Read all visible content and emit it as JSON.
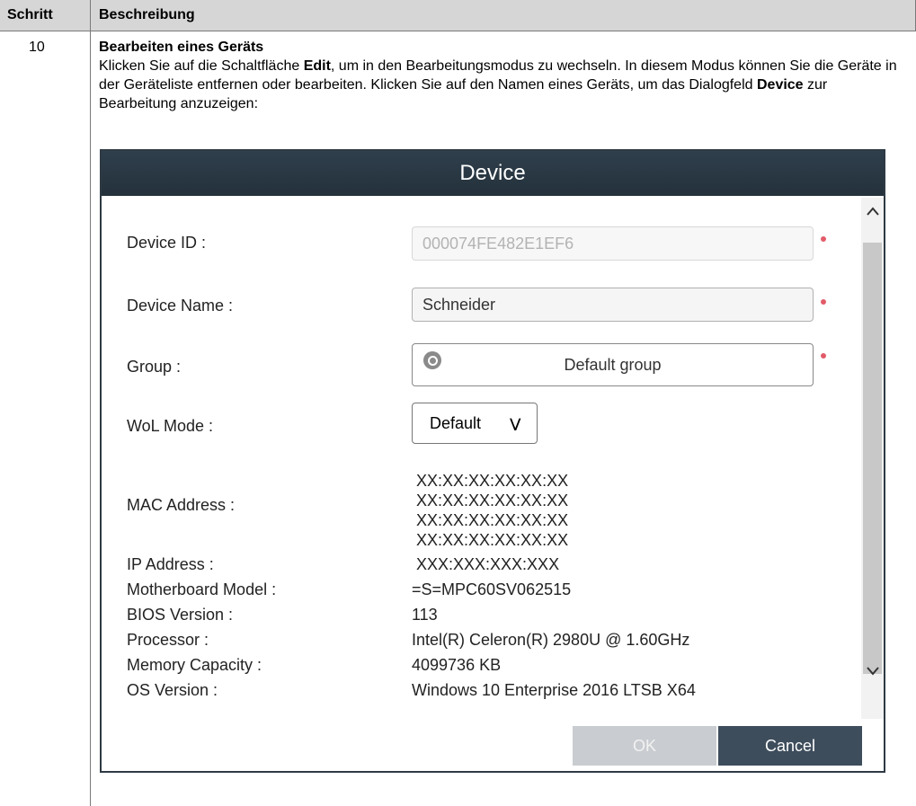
{
  "table": {
    "header_step": "Schritt",
    "header_description": "Beschreibung",
    "step_number": "10",
    "step_title": "Bearbeiten eines Geräts",
    "text_1": "Klicken Sie auf die Schaltfläche ",
    "edit_word": "Edit",
    "text_2": ", um in den Bearbeitungsmodus zu wechseln. In diesem Modus können Sie die Geräte in der Geräteliste entfernen oder bearbeiten. Klicken Sie auf den Namen eines Geräts, um das Dialogfeld ",
    "device_word": "Device",
    "text_3": " zur Bearbeitung anzuzeigen:"
  },
  "dialog": {
    "title": "Device",
    "labels": {
      "device_id": "Device ID :",
      "device_name": "Device Name :",
      "group": "Group :",
      "wol_mode": "WoL Mode :",
      "mac_address": "MAC Address :",
      "ip_address": "IP Address :",
      "motherboard_model": "Motherboard Model :",
      "bios_version": "BIOS Version :",
      "processor": "Processor :",
      "memory_capacity": "Memory Capacity :",
      "os_version": "OS Version :"
    },
    "values": {
      "device_id": "000074FE482E1EF6",
      "device_name": "Schneider",
      "group": "Default group",
      "wol_mode": "Default",
      "mac_addresses": [
        "XX:XX:XX:XX:XX:XX",
        "XX:XX:XX:XX:XX:XX",
        "XX:XX:XX:XX:XX:XX",
        "XX:XX:XX:XX:XX:XX"
      ],
      "ip_address": "XXX:XXX:XXX:XXX",
      "motherboard_model": "=S=MPC60SV062515",
      "bios_version": "113",
      "processor": "Intel(R) Celeron(R) 2980U @ 1.60GHz",
      "memory_capacity": "4099736 KB",
      "os_version": "Windows 10 Enterprise 2016 LTSB X64"
    },
    "buttons": {
      "ok": "OK",
      "cancel": "Cancel"
    },
    "colors": {
      "title_bar": "#2f3f4c",
      "required_marker": "#e25b69",
      "cancel_button": "#3e4d5c",
      "ok_button_disabled": "#c9ccd0"
    }
  }
}
